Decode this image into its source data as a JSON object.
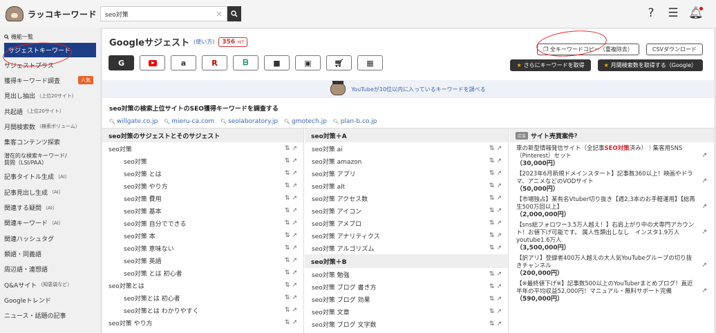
{
  "header": {
    "logo_text": "ラッコキーワード",
    "search_value": "seo対策",
    "search_clear": "×",
    "search_icon": "search-icon",
    "icons": [
      "help-icon",
      "menu-icon",
      "bell-icon"
    ],
    "help_glyph": "?",
    "menu_glyph": "☰",
    "bell_glyph": "🔔︎"
  },
  "sidebar": {
    "heading": "機能一覧",
    "items": [
      {
        "label": "サジェストキーワード",
        "active": true
      },
      {
        "label": "サジェストプラス"
      },
      {
        "label": "獲得キーワード調査",
        "badge": "人気"
      },
      {
        "label": "見出し抽出",
        "sub": "（上位20サイト）"
      },
      {
        "label": "共起語",
        "sub": "（上位20サイト）"
      },
      {
        "label": "月間検索数",
        "sub": "（検索ボリューム）"
      },
      {
        "label": "集客コンテンツ探索"
      },
      {
        "label": "潜在的な検索キーワード/",
        "line2": "質問（LSI/PAA）"
      },
      {
        "label": "記事タイトル生成",
        "sub": "（AI）"
      },
      {
        "label": "記事見出し生成",
        "sub": "（AI）"
      },
      {
        "label": "関連する疑問",
        "sub": "（AI）"
      },
      {
        "label": "関連キーワード",
        "sub": "（AI）"
      },
      {
        "label": "関連ハッシュタグ"
      },
      {
        "label": "類語・同義語"
      },
      {
        "label": "周辺語・連想語"
      },
      {
        "label": "Q&Aサイト",
        "sub": "（知恵袋など）"
      },
      {
        "label": "Googleトレンド"
      },
      {
        "label": "ニュース・話題の記事"
      }
    ]
  },
  "main": {
    "title": "Googleサジェスト",
    "how_to": "(使い方)",
    "hits": "356",
    "hits_unit": "HIT",
    "services": [
      {
        "name": "google",
        "glyph": "G",
        "active": true
      },
      {
        "name": "youtube",
        "glyph": ""
      },
      {
        "name": "amazon",
        "glyph": "a"
      },
      {
        "name": "rakuten",
        "glyph": "R"
      },
      {
        "name": "bing",
        "glyph": "ᗷ"
      },
      {
        "name": "video",
        "glyph": "■"
      },
      {
        "name": "image",
        "glyph": "▣"
      },
      {
        "name": "shopping",
        "glyph": "🛒︎"
      },
      {
        "name": "news",
        "glyph": "▦"
      }
    ],
    "copy_all": "全キーワードコピー（重複除去）",
    "csv_download": "CSVダウンロード",
    "get_more": "さらにキーワードを取得",
    "get_volume": "月間検索数を取得する（Google）",
    "youtube_banner": "YouTubeが10位以内に入っているキーワードを調べる",
    "seo_heading": "seo対策の検索上位サイトのSEO獲得キーワードを調査する",
    "seo_sites": [
      "willgate.co.jp",
      "mieru-ca.com",
      "seolaboratory.jp",
      "gmotech.jp",
      "plan-b.co.jp"
    ]
  },
  "col1": {
    "header": "seo対策のサジェストとそのサジェスト",
    "rows": [
      {
        "text": "seo対策",
        "level": 0
      },
      {
        "text": "seo対策",
        "level": 1
      },
      {
        "text": "seo対策 とは",
        "level": 1
      },
      {
        "text": "seo対策 やり方",
        "level": 1
      },
      {
        "text": "seo対策 費用",
        "level": 1
      },
      {
        "text": "seo対策 基本",
        "level": 1
      },
      {
        "text": "seo対策 自分でできる",
        "level": 1
      },
      {
        "text": "seo対策 本",
        "level": 1
      },
      {
        "text": "seo対策 意味ない",
        "level": 1
      },
      {
        "text": "seo対策 英語",
        "level": 1
      },
      {
        "text": "seo対策 とは 初心者",
        "level": 1
      },
      {
        "text": "seo対策とは",
        "level": 0
      },
      {
        "text": "seo対策とは 初心者",
        "level": 1
      },
      {
        "text": "seo対策とは わかりやすく",
        "level": 1
      },
      {
        "text": "seo対策 やり方",
        "level": 0
      }
    ]
  },
  "col2": {
    "header_a": "seo対策＋A",
    "rows_a": [
      "seo対策 ai",
      "seo対策 amazon",
      "seo対策 アプリ",
      "seo対策 alt",
      "seo対策 アクセス数",
      "seo対策 アイコン",
      "seo対策 アメブロ",
      "seo対策 アナリティクス",
      "seo対策 アルゴリズム"
    ],
    "header_b": "seo対策＋B",
    "rows_b": [
      "seo対策 勉強",
      "seo対策 ブログ 書き方",
      "seo対策 ブログ 効果",
      "seo対策 文章",
      "seo対策 ブログ 文字数"
    ]
  },
  "ads": {
    "badge": "広告",
    "title": "サイト売買案件",
    "help": "?",
    "items": [
      {
        "pre": "車の新型情報発信サイト（全記事",
        "hl": "SEO対策",
        "post": "済み）｜集客用SNS（Pinterest）セット",
        "price": "（30,000円）"
      },
      {
        "pre": "【2023年6月新規ドメインスタート】記事数360以上！映画やドラマ、アニメなどのVODサイト",
        "hl": "",
        "post": "",
        "price": "（50,000円）"
      },
      {
        "pre": "【市場独占】某有名Vtuber切り抜き【週2,3本のお手軽運用】【総再生500万回以上】",
        "hl": "",
        "post": "",
        "price": "（2,000,000円）"
      },
      {
        "pre": "【sns総フォロワー3.5万人越え！】右肩上がり中の犬専門アカウント！お値下げ可能です。 属人性類出しなし　インスタ1.9万人　youtube1.6万人",
        "hl": "",
        "post": "",
        "price": "（3,500,000円）"
      },
      {
        "pre": "【訳アリ】登録者400万人越えの大人気YouTubeグループの切り抜きチャンネル",
        "hl": "",
        "post": "",
        "price": "（200,000円）"
      },
      {
        "pre": "【※最終値下げ※】記事数500以上のYouTuberまとめブログ！直近半年の平均収益52,000円！マニュアル・無料サポート完備",
        "hl": "",
        "post": "",
        "price": "（590,000円）"
      }
    ]
  }
}
